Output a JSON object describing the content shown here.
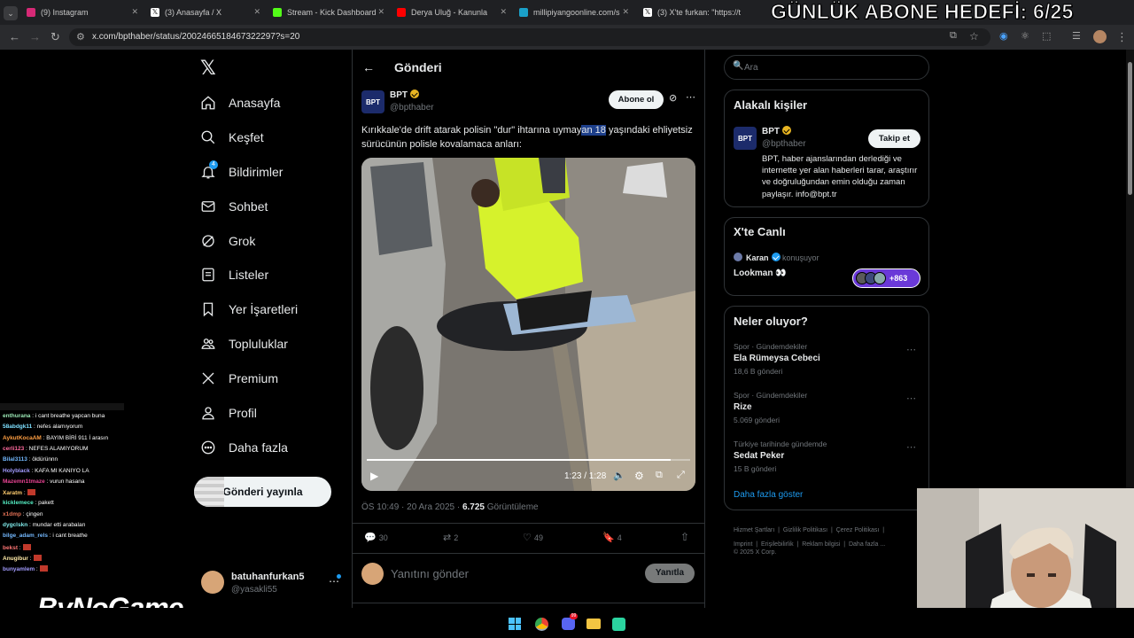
{
  "browser": {
    "tabs": [
      {
        "title": "(9) Instagram",
        "color": "#d62976"
      },
      {
        "title": "(3) Anasayfa / X",
        "color": "#ffffff"
      },
      {
        "title": "Stream - Kick Dashboard",
        "color": "#53fc18"
      },
      {
        "title": "Derya Uluğ - Kanunla",
        "color": "#ff0000"
      },
      {
        "title": "millipiyangoonline.com/s",
        "color": "#1aa0c8"
      },
      {
        "title": "(3) X'te furkan: \"https://t",
        "color": "#ffffff"
      }
    ],
    "url": "x.com/bpthaber/status/2002466518467322297?s=20"
  },
  "overlay": {
    "goal_text": "GÜNLÜK ABONE HEDEFİ: 6/25"
  },
  "nav": {
    "items": [
      {
        "label": "Anasayfa",
        "icon": "home-icon"
      },
      {
        "label": "Keşfet",
        "icon": "search-icon"
      },
      {
        "label": "Bildirimler",
        "icon": "bell-icon",
        "badge": "4"
      },
      {
        "label": "Sohbet",
        "icon": "mail-icon"
      },
      {
        "label": "Grok",
        "icon": "grok-icon"
      },
      {
        "label": "Listeler",
        "icon": "list-icon"
      },
      {
        "label": "Yer İşaretleri",
        "icon": "bookmark-icon"
      },
      {
        "label": "Topluluklar",
        "icon": "communities-icon"
      },
      {
        "label": "Premium",
        "icon": "x-logo-icon"
      },
      {
        "label": "Profil",
        "icon": "profile-icon"
      },
      {
        "label": "Daha fazla",
        "icon": "more-circle-icon"
      }
    ],
    "post_button": "Gönderi yayınla",
    "account": {
      "name": "batuhanfurkan5",
      "handle": "@yasakli55"
    }
  },
  "post": {
    "header": "Gönderi",
    "author_name": "BPT",
    "author_handle": "@bpthaber",
    "subscribe_label": "Abone ol",
    "text_before": "Kırıkkale'de drift atarak polisin \"dur\" ihtarına uymay",
    "text_highlight": "an 18",
    "text_after": " yaşındaki ehliyetsiz sürücünün polisle kovalamaca anları:",
    "video_time": "1:23 / 1:28",
    "video_progress": 0.94,
    "timestamp": "ÖS 10:49 · 20 Ara 2025 · ",
    "views_count": "6.725",
    "views_label": " Görüntüleme",
    "stats": {
      "replies": "30",
      "reposts": "2",
      "likes": "49",
      "bookmarks": "4"
    },
    "reply_placeholder": "Yanıtını gönder",
    "reply_button": "Yanıtla"
  },
  "right": {
    "search_placeholder": "Ara",
    "related": {
      "title": "Alakalı kişiler",
      "name": "BPT",
      "handle": "@bpthaber",
      "follow_label": "Takip et",
      "bio": "BPT, haber ajanslarından derlediği ve internette yer alan haberleri tarar, araştırır ve doğruluğundan emin olduğu zaman paylaşır. info@bpt.tr"
    },
    "live": {
      "title": "X'te Canlı",
      "host": "Karan",
      "status": "konuşuyor",
      "space_title": "Lookman 👀",
      "listeners": "+863"
    },
    "trends": {
      "title": "Neler oluyor?",
      "items": [
        {
          "meta": "Spor · Gündemdekiler",
          "name": "Ela Rümeysa Cebeci",
          "count": "18,6 B gönderi"
        },
        {
          "meta": "Spor · Gündemdekiler",
          "name": "Rize",
          "count": "5.069 gönderi"
        },
        {
          "meta": "Türkiye tarihinde gündemde",
          "name": "Sedat Peker",
          "count": "15 B gönderi"
        }
      ],
      "show_more": "Daha fazla göster"
    },
    "footer": {
      "links": [
        "Hizmet Şartları",
        "Gizlilik Politikası",
        "Çerez Politikası",
        "Imprint",
        "Erişilebilirlik",
        "Reklam bilgisi",
        "Daha fazla ..."
      ],
      "copyright": "© 2025 X Corp."
    }
  },
  "chat": {
    "lines": [
      {
        "user": "enthurana",
        "msg": "i cant breathe yapcan buna",
        "color": "#9ae6b4"
      },
      {
        "user": "58abdgk11",
        "msg": "nefes alamıyorum",
        "color": "#7ee0ff"
      },
      {
        "user": "AykutKocaAM",
        "msg": "BAYIM BİRİ 911 İ arasın",
        "color": "#ff9f43"
      },
      {
        "user": "cerli123",
        "msg": "NEFES ALAMIYORUM",
        "color": "#ff6b9e"
      },
      {
        "user": "Bilal3113",
        "msg": "öldürünnn",
        "color": "#74b9ff"
      },
      {
        "user": "Holyblack",
        "msg": "KAFA MI KANIYO LA",
        "color": "#a29bfe"
      },
      {
        "user": "Mazemn1tmaze",
        "msg": "vurun hasana",
        "color": "#e84393"
      },
      {
        "user": "Xaratm",
        "msg": "",
        "color": "#fdcb6e"
      },
      {
        "user": "kicklemece",
        "msg": "pakett",
        "color": "#55efc4"
      },
      {
        "user": "x1dmp",
        "msg": "çingen",
        "color": "#e17055"
      },
      {
        "user": "dygclskn",
        "msg": "mundar etti arabaları",
        "color": "#81ecec"
      },
      {
        "user": "bilge_adam_rels",
        "msg": "i cant breathe",
        "color": "#74b9ff"
      },
      {
        "user": "bekst",
        "msg": "",
        "color": "#ff7675"
      },
      {
        "user": "Anugibur",
        "msg": "",
        "color": "#ffeaa7"
      },
      {
        "user": "bunyamlem",
        "msg": "",
        "color": "#a29bfe"
      }
    ],
    "watermark": "ByNoGame"
  }
}
